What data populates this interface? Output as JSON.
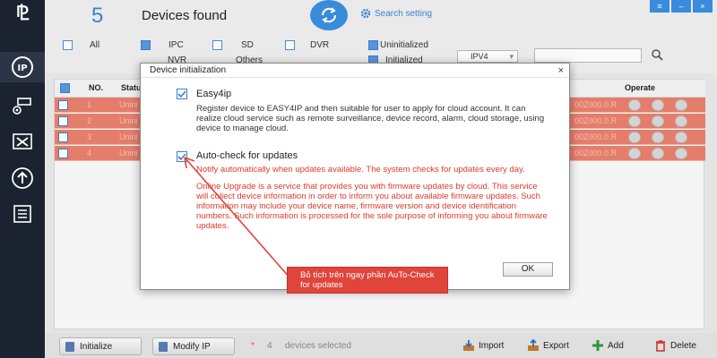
{
  "topbar": {
    "device_count": "5",
    "devices_found_label": "Devices found",
    "search_setting_label": "Search setting"
  },
  "filters": {
    "all": "All",
    "ipc": "IPC",
    "sd": "SD",
    "dvr": "DVR",
    "nvr": "NVR",
    "others": "Others",
    "uninitialized": "Uninitialized",
    "initialized": "Initialized",
    "ip_version": "IPV4"
  },
  "table": {
    "headers": {
      "no": "NO.",
      "status": "Statu",
      "operate": "Operate"
    },
    "rows": [
      {
        "no": "1",
        "status": "Unini",
        "tail": "00Z000.0.R"
      },
      {
        "no": "2",
        "status": "Unini",
        "tail": "00Z000.0.R"
      },
      {
        "no": "3",
        "status": "Unini",
        "tail": "00Z000.0.R"
      },
      {
        "no": "4",
        "status": "Unini",
        "tail": "00Z000.0.R"
      }
    ]
  },
  "bottombar": {
    "initialize": "Initialize",
    "modify_ip": "Modify IP",
    "selected_count": "4",
    "selected_label": "devices selected",
    "import": "Import",
    "export": "Export",
    "add": "Add",
    "delete": "Delete"
  },
  "dialog": {
    "title": "Device initialization",
    "close": "×",
    "easy4ip_title": "Easy4ip",
    "easy4ip_desc": "Register device to EASY4IP and then suitable for user to apply for cloud account. It can realize cloud service such as remote surveillance, device record, alarm, cloud storage, using device to manage cloud.",
    "autocheck_title": "Auto-check for updates",
    "autocheck_desc": "Notify automatically when updates available. The system checks for updates every day.",
    "online_desc": "Online Upgrade is a service that provides you with firmware updates by cloud. This service will collect device information in order to inform you about available firmware updates. Such information may include your device name, firmware version and device identification numbers. Such information is processed for the sole purpose of informing you about firmware updates.",
    "ok": "OK"
  },
  "annotation": {
    "callout": "Bỏ tích trên ngay phần AuTo-Check for updates"
  },
  "colors": {
    "accent": "#3b8fe0",
    "row_highlight": "#e9806e",
    "callout_red": "#e0443a"
  }
}
